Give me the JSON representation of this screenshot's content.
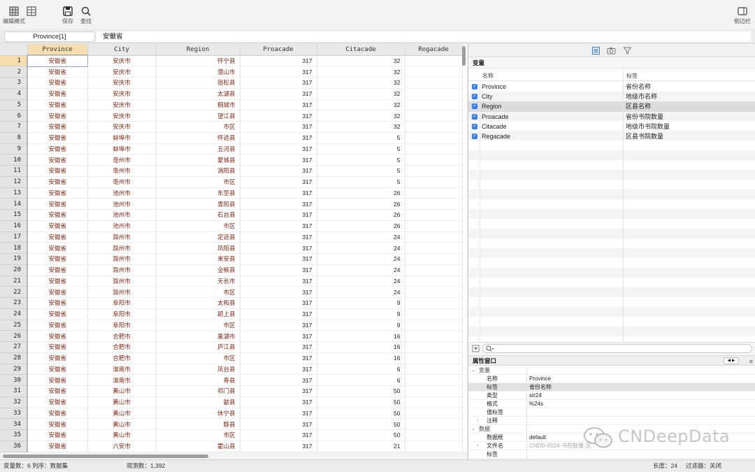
{
  "toolbar": {
    "edit_mode_label": "编辑模式",
    "save_label": "保存",
    "find_label": "查找",
    "sidebar_label": "侧边栏"
  },
  "editbar": {
    "cell_ref": "Province[1]",
    "cell_value": "安徽省"
  },
  "grid": {
    "columns": [
      "Province",
      "City",
      "Region",
      "Proacade",
      "Citacade",
      "Regacade"
    ],
    "rows": [
      [
        "安徽省",
        "安庆市",
        "怀宁县",
        "317",
        "32",
        ""
      ],
      [
        "安徽省",
        "安庆市",
        "潜山市",
        "317",
        "32",
        ""
      ],
      [
        "安徽省",
        "安庆市",
        "宿松县",
        "317",
        "32",
        ""
      ],
      [
        "安徽省",
        "安庆市",
        "太湖县",
        "317",
        "32",
        ""
      ],
      [
        "安徽省",
        "安庆市",
        "桐城市",
        "317",
        "32",
        ""
      ],
      [
        "安徽省",
        "安庆市",
        "望江县",
        "317",
        "32",
        ""
      ],
      [
        "安徽省",
        "安庆市",
        "市区",
        "317",
        "32",
        ""
      ],
      [
        "安徽省",
        "蚌埠市",
        "怀远县",
        "317",
        "5",
        ""
      ],
      [
        "安徽省",
        "蚌埠市",
        "五河县",
        "317",
        "5",
        ""
      ],
      [
        "安徽省",
        "亳州市",
        "蒙城县",
        "317",
        "5",
        ""
      ],
      [
        "安徽省",
        "亳州市",
        "涡阳县",
        "317",
        "5",
        ""
      ],
      [
        "安徽省",
        "亳州市",
        "市区",
        "317",
        "5",
        ""
      ],
      [
        "安徽省",
        "池州市",
        "东至县",
        "317",
        "26",
        ""
      ],
      [
        "安徽省",
        "池州市",
        "青阳县",
        "317",
        "26",
        ""
      ],
      [
        "安徽省",
        "池州市",
        "石台县",
        "317",
        "26",
        ""
      ],
      [
        "安徽省",
        "池州市",
        "市区",
        "317",
        "26",
        ""
      ],
      [
        "安徽省",
        "滁州市",
        "定远县",
        "317",
        "24",
        ""
      ],
      [
        "安徽省",
        "滁州市",
        "凤阳县",
        "317",
        "24",
        ""
      ],
      [
        "安徽省",
        "滁州市",
        "来安县",
        "317",
        "24",
        ""
      ],
      [
        "安徽省",
        "滁州市",
        "全椒县",
        "317",
        "24",
        ""
      ],
      [
        "安徽省",
        "滁州市",
        "天长市",
        "317",
        "24",
        ""
      ],
      [
        "安徽省",
        "滁州市",
        "市区",
        "317",
        "24",
        ""
      ],
      [
        "安徽省",
        "阜阳市",
        "太和县",
        "317",
        "9",
        ""
      ],
      [
        "安徽省",
        "阜阳市",
        "颍上县",
        "317",
        "9",
        ""
      ],
      [
        "安徽省",
        "阜阳市",
        "市区",
        "317",
        "9",
        ""
      ],
      [
        "安徽省",
        "合肥市",
        "巢湖市",
        "317",
        "16",
        ""
      ],
      [
        "安徽省",
        "合肥市",
        "庐江县",
        "317",
        "16",
        ""
      ],
      [
        "安徽省",
        "合肥市",
        "市区",
        "317",
        "16",
        ""
      ],
      [
        "安徽省",
        "淮南市",
        "凤台县",
        "317",
        "6",
        ""
      ],
      [
        "安徽省",
        "淮南市",
        "寿县",
        "317",
        "6",
        ""
      ],
      [
        "安徽省",
        "黄山市",
        "祁门县",
        "317",
        "50",
        ""
      ],
      [
        "安徽省",
        "黄山市",
        "歙县",
        "317",
        "50",
        ""
      ],
      [
        "安徽省",
        "黄山市",
        "休宁县",
        "317",
        "50",
        ""
      ],
      [
        "安徽省",
        "黄山市",
        "黟县",
        "317",
        "50",
        ""
      ],
      [
        "安徽省",
        "黄山市",
        "市区",
        "317",
        "50",
        ""
      ],
      [
        "安徽省",
        "六安市",
        "霍山县",
        "317",
        "21",
        ""
      ]
    ]
  },
  "variables": {
    "title": "变量",
    "col_name": "名称",
    "col_label": "标签",
    "items": [
      {
        "name": "Province",
        "label": "省份名称"
      },
      {
        "name": "City",
        "label": "地级市名称"
      },
      {
        "name": "Region",
        "label": "区县名称"
      },
      {
        "name": "Proacade",
        "label": "省份书院数量"
      },
      {
        "name": "Citacade",
        "label": "地级市书院数量"
      },
      {
        "name": "Regacade",
        "label": "区县书院数量"
      }
    ]
  },
  "properties": {
    "title": "属性窗口",
    "nav": "◀ ▶",
    "var_section": "变量",
    "name_k": "名称",
    "name_v": "Province",
    "label_k": "标签",
    "label_v": "省份名称",
    "type_k": "类型",
    "type_v": "str24",
    "format_k": "格式",
    "format_v": "%24s",
    "vallab_k": "值标签",
    "vallab_v": "",
    "notes_k": "注释",
    "data_section": "数据",
    "frame_k": "数据框",
    "frame_v": "default",
    "file_k": "文件名",
    "file_v": "CNDD-0024-书院数量-区",
    "dlabel_k": "标签"
  },
  "status": {
    "vars": "变量数：6  列序：数据集",
    "obs": "观测数：1,392",
    "width": "长度：24",
    "filter": "过滤器：关闭"
  },
  "watermark": "CNDeepData",
  "colors": {
    "accent": "#3a7ee8",
    "selected_header": "#f6deb0",
    "cell_text": "#7b2a16"
  }
}
